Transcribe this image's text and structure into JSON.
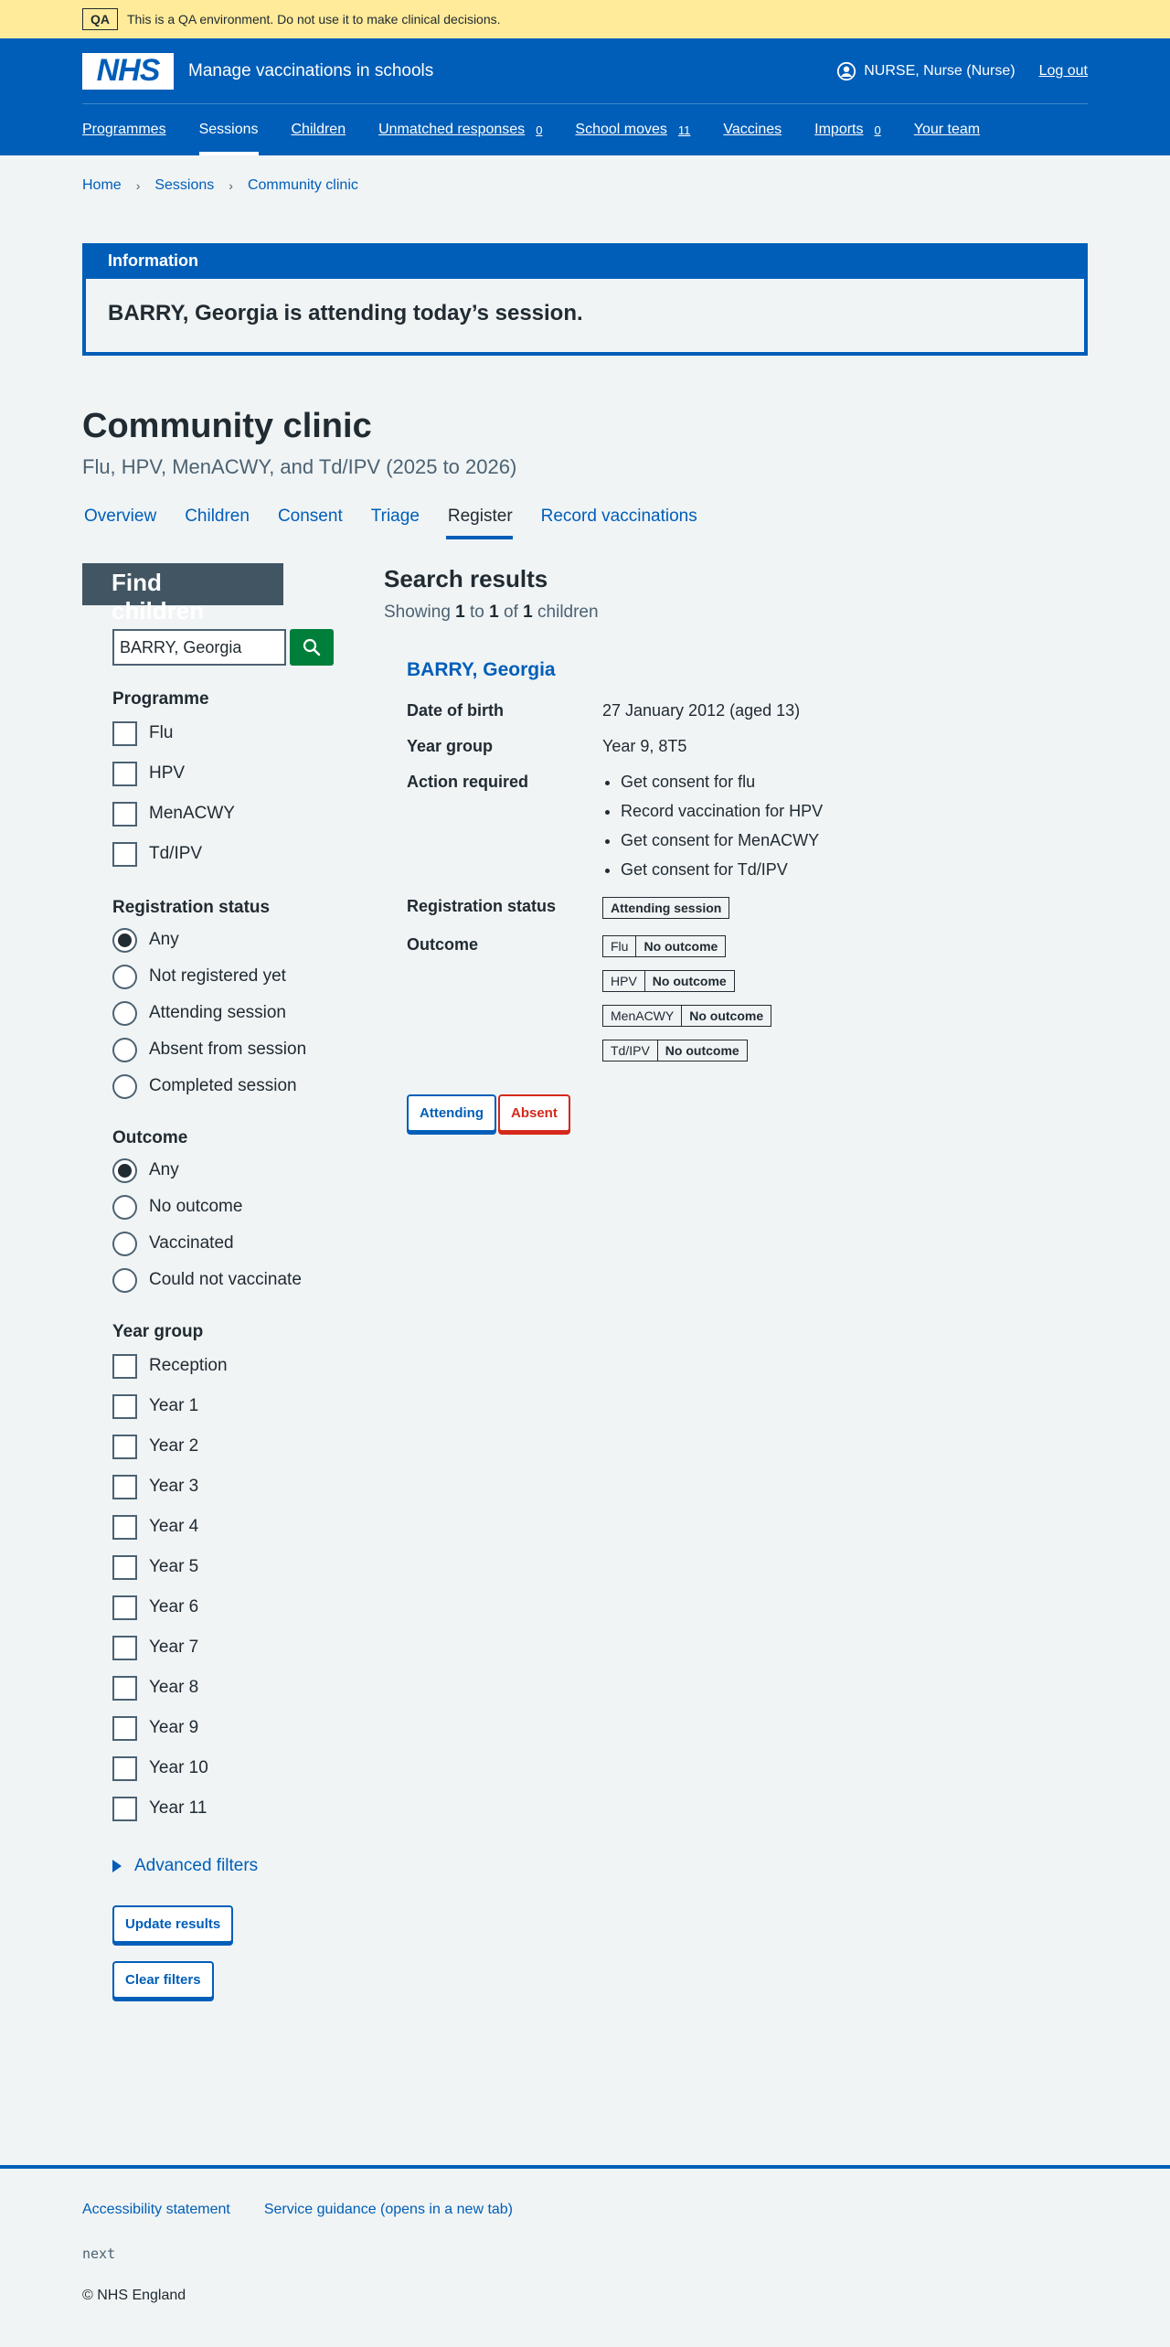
{
  "qa_banner": {
    "tag": "QA",
    "text": "This is a QA environment. Do not use it to make clinical decisions."
  },
  "header": {
    "logo": "NHS",
    "service": "Manage vaccinations in schools",
    "user": "NURSE, Nurse (Nurse)",
    "logout": "Log out",
    "nav": [
      {
        "label": "Programmes",
        "count": ""
      },
      {
        "label": "Sessions",
        "count": ""
      },
      {
        "label": "Children",
        "count": ""
      },
      {
        "label": "Unmatched responses",
        "count": "0"
      },
      {
        "label": "School moves",
        "count": "11"
      },
      {
        "label": "Vaccines",
        "count": ""
      },
      {
        "label": "Imports",
        "count": "0"
      },
      {
        "label": "Your team",
        "count": ""
      }
    ]
  },
  "breadcrumb": [
    "Home",
    "Sessions",
    "Community clinic"
  ],
  "info": {
    "heading": "Information",
    "message": "BARRY, Georgia is attending today’s session."
  },
  "page": {
    "title": "Community clinic",
    "caption": "Flu, HPV, MenACWY, and Td/IPV (2025 to 2026)"
  },
  "tabs": [
    "Overview",
    "Children",
    "Consent",
    "Triage",
    "Register",
    "Record vaccinations"
  ],
  "filters": {
    "heading": "Find children",
    "search_value": "BARRY, Georgia",
    "programme": {
      "legend": "Programme",
      "options": [
        "Flu",
        "HPV",
        "MenACWY",
        "Td/IPV"
      ]
    },
    "registration": {
      "legend": "Registration status",
      "options": [
        "Any",
        "Not registered yet",
        "Attending session",
        "Absent from session",
        "Completed session"
      ]
    },
    "outcome": {
      "legend": "Outcome",
      "options": [
        "Any",
        "No outcome",
        "Vaccinated",
        "Could not vaccinate"
      ]
    },
    "year_group": {
      "legend": "Year group",
      "options": [
        "Reception",
        "Year 1",
        "Year 2",
        "Year 3",
        "Year 4",
        "Year 5",
        "Year 6",
        "Year 7",
        "Year 8",
        "Year 9",
        "Year 10",
        "Year 11"
      ]
    },
    "advanced": "Advanced filters",
    "update_button": "Update results",
    "clear_button": "Clear filters"
  },
  "results": {
    "heading": "Search results",
    "showing_prefix": "Showing",
    "from": "1",
    "to_word": "to",
    "to": "1",
    "of_word": "of",
    "total": "1",
    "suffix": "children",
    "child": {
      "name": "BARRY, Georgia",
      "dob_label": "Date of birth",
      "dob": "27 January 2012 (aged 13)",
      "year_label": "Year group",
      "year": "Year 9, 8T5",
      "action_label": "Action required",
      "actions": [
        "Get consent for flu",
        "Record vaccination for HPV",
        "Get consent for MenACWY",
        "Get consent for Td/IPV"
      ],
      "registration_label": "Registration status",
      "registration": "Attending session",
      "outcome_label": "Outcome",
      "outcomes": [
        {
          "programme": "Flu",
          "status": "No outcome"
        },
        {
          "programme": "HPV",
          "status": "No outcome"
        },
        {
          "programme": "MenACWY",
          "status": "No outcome"
        },
        {
          "programme": "Td/IPV",
          "status": "No outcome"
        }
      ],
      "attending_button": "Attending",
      "absent_button": "Absent"
    }
  },
  "footer": {
    "links": [
      "Accessibility statement",
      "Service guidance (opens in a new tab)"
    ],
    "next": "next",
    "copyright": "© NHS England"
  }
}
